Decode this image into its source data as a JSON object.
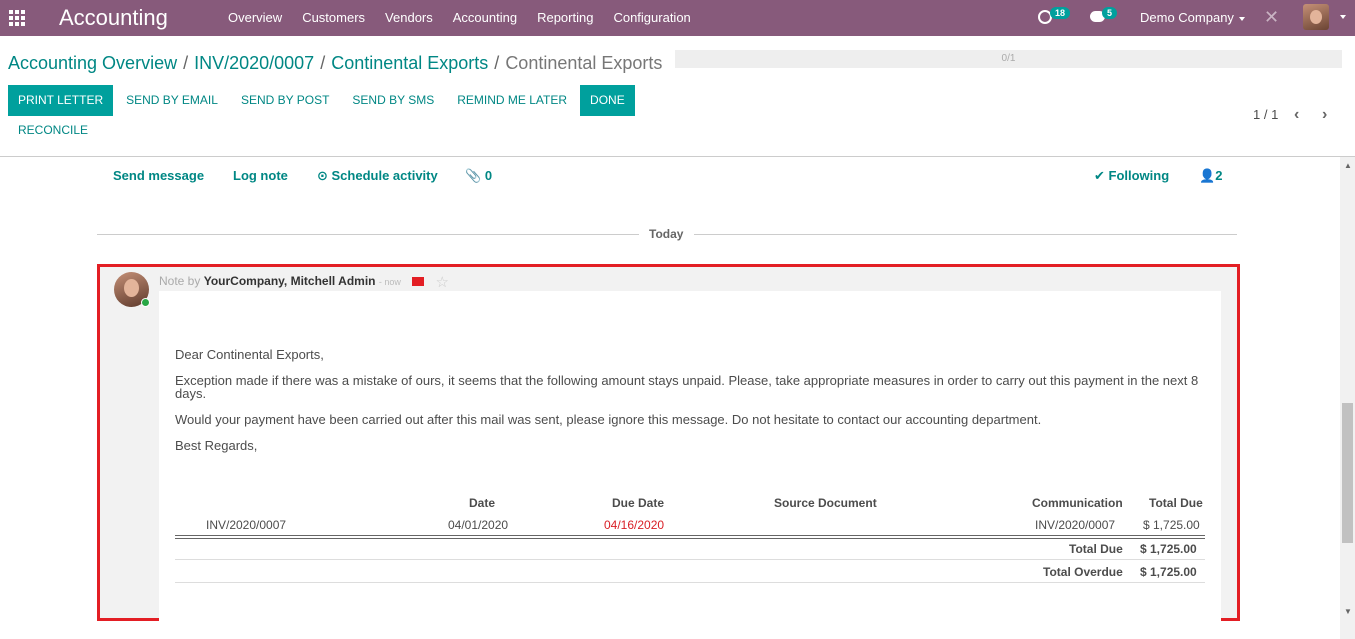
{
  "navbar": {
    "brand": "Accounting",
    "menu": [
      "Overview",
      "Customers",
      "Vendors",
      "Accounting",
      "Reporting",
      "Configuration"
    ],
    "activity_count": "18",
    "message_count": "5",
    "company": "Demo Company",
    "close_symbol": "✕"
  },
  "breadcrumb": {
    "items": [
      "Accounting Overview",
      "INV/2020/0007",
      "Continental Exports"
    ],
    "active": "Continental Exports",
    "separator": "/"
  },
  "progress": {
    "label": "0/1"
  },
  "actions": {
    "print_letter": "PRINT LETTER",
    "send_by_email": "SEND BY EMAIL",
    "send_by_post": "SEND BY POST",
    "send_by_sms": "SEND BY SMS",
    "remind_me_later": "REMIND ME LATER",
    "done": "DONE",
    "reconcile": "RECONCILE"
  },
  "pager": {
    "label": "1 / 1"
  },
  "chatter": {
    "send_message": "Send message",
    "log_note": "Log note",
    "schedule_activity": "⊙ Schedule activity",
    "attachments": "0",
    "following": "✔ Following",
    "followers": "2",
    "today": "Today"
  },
  "message": {
    "prefix": "Note by",
    "author": "YourCompany, Mitchell Admin",
    "time": "- now",
    "greeting": "Dear Continental Exports,",
    "paragraph1": "Exception made if there was a mistake of ours, it seems that the following amount stays unpaid. Please, take appropriate measures in order to carry out this payment in the next 8 days.",
    "paragraph2": "Would your payment have been carried out after this mail was sent, please ignore this message. Do not hesitate to contact our accounting department.",
    "closing": "Best Regards,"
  },
  "table": {
    "headers": {
      "date": "Date",
      "due_date": "Due Date",
      "source": "Source Document",
      "communication": "Communication",
      "total_due": "Total Due"
    },
    "row": {
      "invoice": "INV/2020/0007",
      "date": "04/01/2020",
      "due_date": "04/16/2020",
      "source": "",
      "communication": "INV/2020/0007",
      "total_due": "$ 1,725.00"
    },
    "totals": {
      "total_due_label": "Total Due",
      "total_due_value": "$ 1,725.00",
      "total_overdue_label": "Total Overdue",
      "total_overdue_value": "$ 1,725.00"
    }
  },
  "colors": {
    "navbar": "#875a7b",
    "primary": "#00a09d",
    "link": "#008784",
    "highlight": "#e31e24",
    "overdue": "#d91f26"
  }
}
